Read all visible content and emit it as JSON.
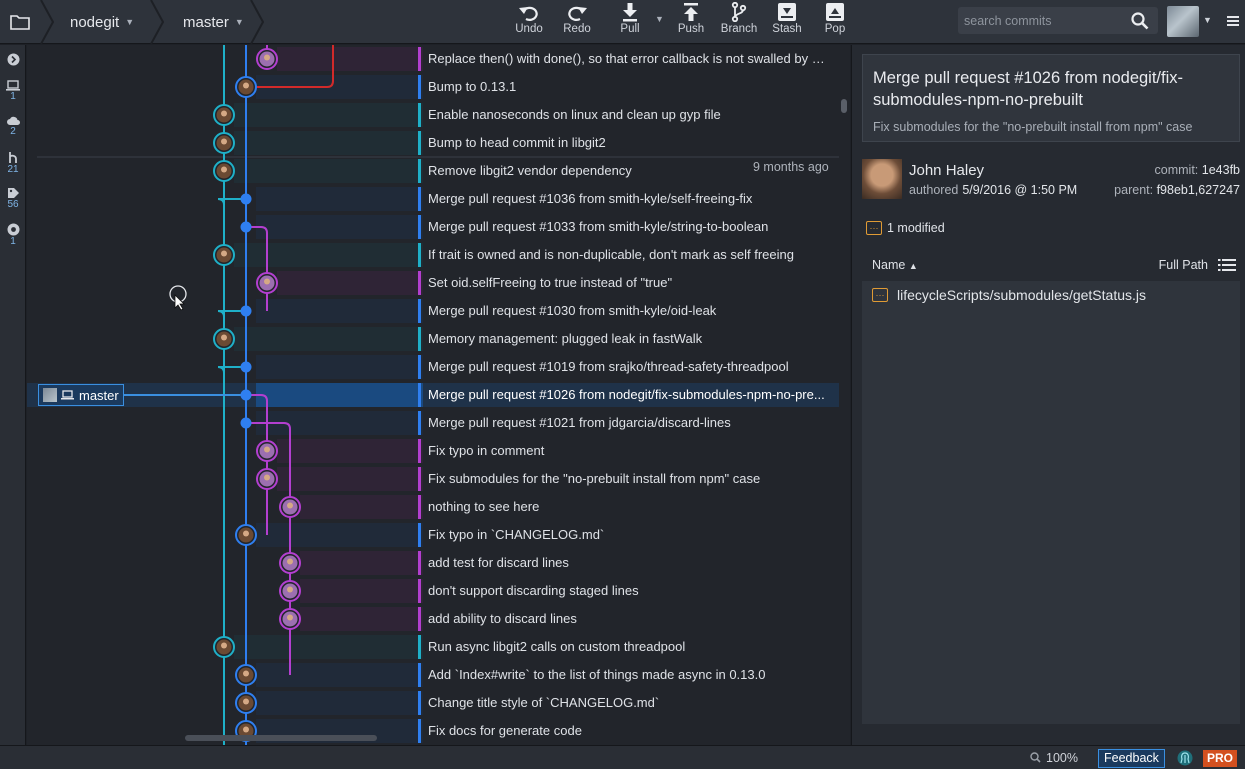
{
  "toolbar": {
    "repo": "nodegit",
    "branch": "master",
    "undo_label": "Undo",
    "redo_label": "Redo",
    "pull_label": "Pull",
    "push_label": "Push",
    "branch_label": "Branch",
    "stash_label": "Stash",
    "pop_label": "Pop",
    "search_placeholder": "search commits"
  },
  "rail": {
    "local_count": "1",
    "remote_count": "2",
    "pr_count": "21",
    "tag_count": "56",
    "submodule_count": "1"
  },
  "graph": {
    "date_label": "9 months ago",
    "head_branch": "master",
    "commits": [
      {
        "message": "Replace then() with done(), so that error callback is not swalled by rev...",
        "lane": 2,
        "color": "#b33fd0"
      },
      {
        "message": "Bump to 0.13.1",
        "lane": 1,
        "color": "#2f7ff0"
      },
      {
        "message": "Enable nanoseconds on linux and clean up gyp file",
        "lane": 0,
        "color": "#1fb0c8"
      },
      {
        "message": "Bump to head commit in libgit2",
        "lane": 0,
        "color": "#1fb0c8"
      },
      {
        "message": "Remove libgit2 vendor dependency",
        "lane": 0,
        "color": "#1fb0c8"
      },
      {
        "message": "Merge pull request #1036 from smith-kyle/self-freeing-fix",
        "lane": 1,
        "color": "#2f7ff0"
      },
      {
        "message": "Merge pull request #1033 from smith-kyle/string-to-boolean",
        "lane": 1,
        "color": "#2f7ff0"
      },
      {
        "message": "If trait is owned and is non-duplicable, don't mark as self freeing",
        "lane": 0,
        "color": "#1fb0c8"
      },
      {
        "message": "Set oid.selfFreeing to true instead of \"true\"",
        "lane": 2,
        "color": "#b33fd0"
      },
      {
        "message": "Merge pull request #1030 from smith-kyle/oid-leak",
        "lane": 1,
        "color": "#2f7ff0"
      },
      {
        "message": "Memory management: plugged leak in fastWalk",
        "lane": 0,
        "color": "#1fb0c8"
      },
      {
        "message": "Merge pull request #1019 from srajko/thread-safety-threadpool",
        "lane": 1,
        "color": "#2f7ff0"
      },
      {
        "message": "Merge pull request #1026 from nodegit/fix-submodules-npm-no-pre...",
        "lane": 1,
        "color": "#2f7ff0"
      },
      {
        "message": "Merge pull request #1021 from jdgarcia/discard-lines",
        "lane": 1,
        "color": "#2f7ff0"
      },
      {
        "message": "Fix typo in comment",
        "lane": 2,
        "color": "#b33fd0"
      },
      {
        "message": "Fix submodules for the \"no-prebuilt install from npm\" case",
        "lane": 2,
        "color": "#b33fd0"
      },
      {
        "message": "nothing to see here",
        "lane": 3,
        "color": "#b33fd0"
      },
      {
        "message": "Fix typo in `CHANGELOG.md`",
        "lane": 1,
        "color": "#2f7ff0"
      },
      {
        "message": "add test for discard lines",
        "lane": 3,
        "color": "#b33fd0"
      },
      {
        "message": "don't support discarding staged lines",
        "lane": 3,
        "color": "#b33fd0"
      },
      {
        "message": "add ability to discard lines",
        "lane": 3,
        "color": "#b33fd0"
      },
      {
        "message": "Run async libgit2 calls on custom threadpool",
        "lane": 0,
        "color": "#1fb0c8"
      },
      {
        "message": "Add `Index#write` to the list of things made async in 0.13.0",
        "lane": 1,
        "color": "#2f7ff0"
      },
      {
        "message": "Change title style of `CHANGELOG.md`",
        "lane": 1,
        "color": "#2f7ff0"
      },
      {
        "message": "Fix docs for generate code",
        "lane": 1,
        "color": "#2f7ff0"
      }
    ]
  },
  "detail": {
    "title": "Merge pull request #1026 from nodegit/fix-submodules-npm-no-prebuilt",
    "description": "Fix submodules for the \"no-prebuilt install from npm\" case",
    "author": "John Haley",
    "authored_label": "authored",
    "authored_date": "5/9/2016 @ 1:50 PM",
    "commit_label": "commit:",
    "commit_sha": "1e43fb",
    "parent_label": "parent:",
    "parent_sha": "f98eb1,627247",
    "modified_label": "1 modified",
    "name_col": "Name",
    "path_col": "Full Path",
    "file": "lifecycleScripts/submodules/getStatus.js"
  },
  "status": {
    "zoom": "100%",
    "feedback": "Feedback",
    "pro": "PRO"
  },
  "colors": {
    "cyan": "#1fb0c8",
    "blue": "#2f7ff0",
    "purple": "#b33fd0",
    "red": "#d22a2a",
    "selected": "#1b4a80"
  }
}
